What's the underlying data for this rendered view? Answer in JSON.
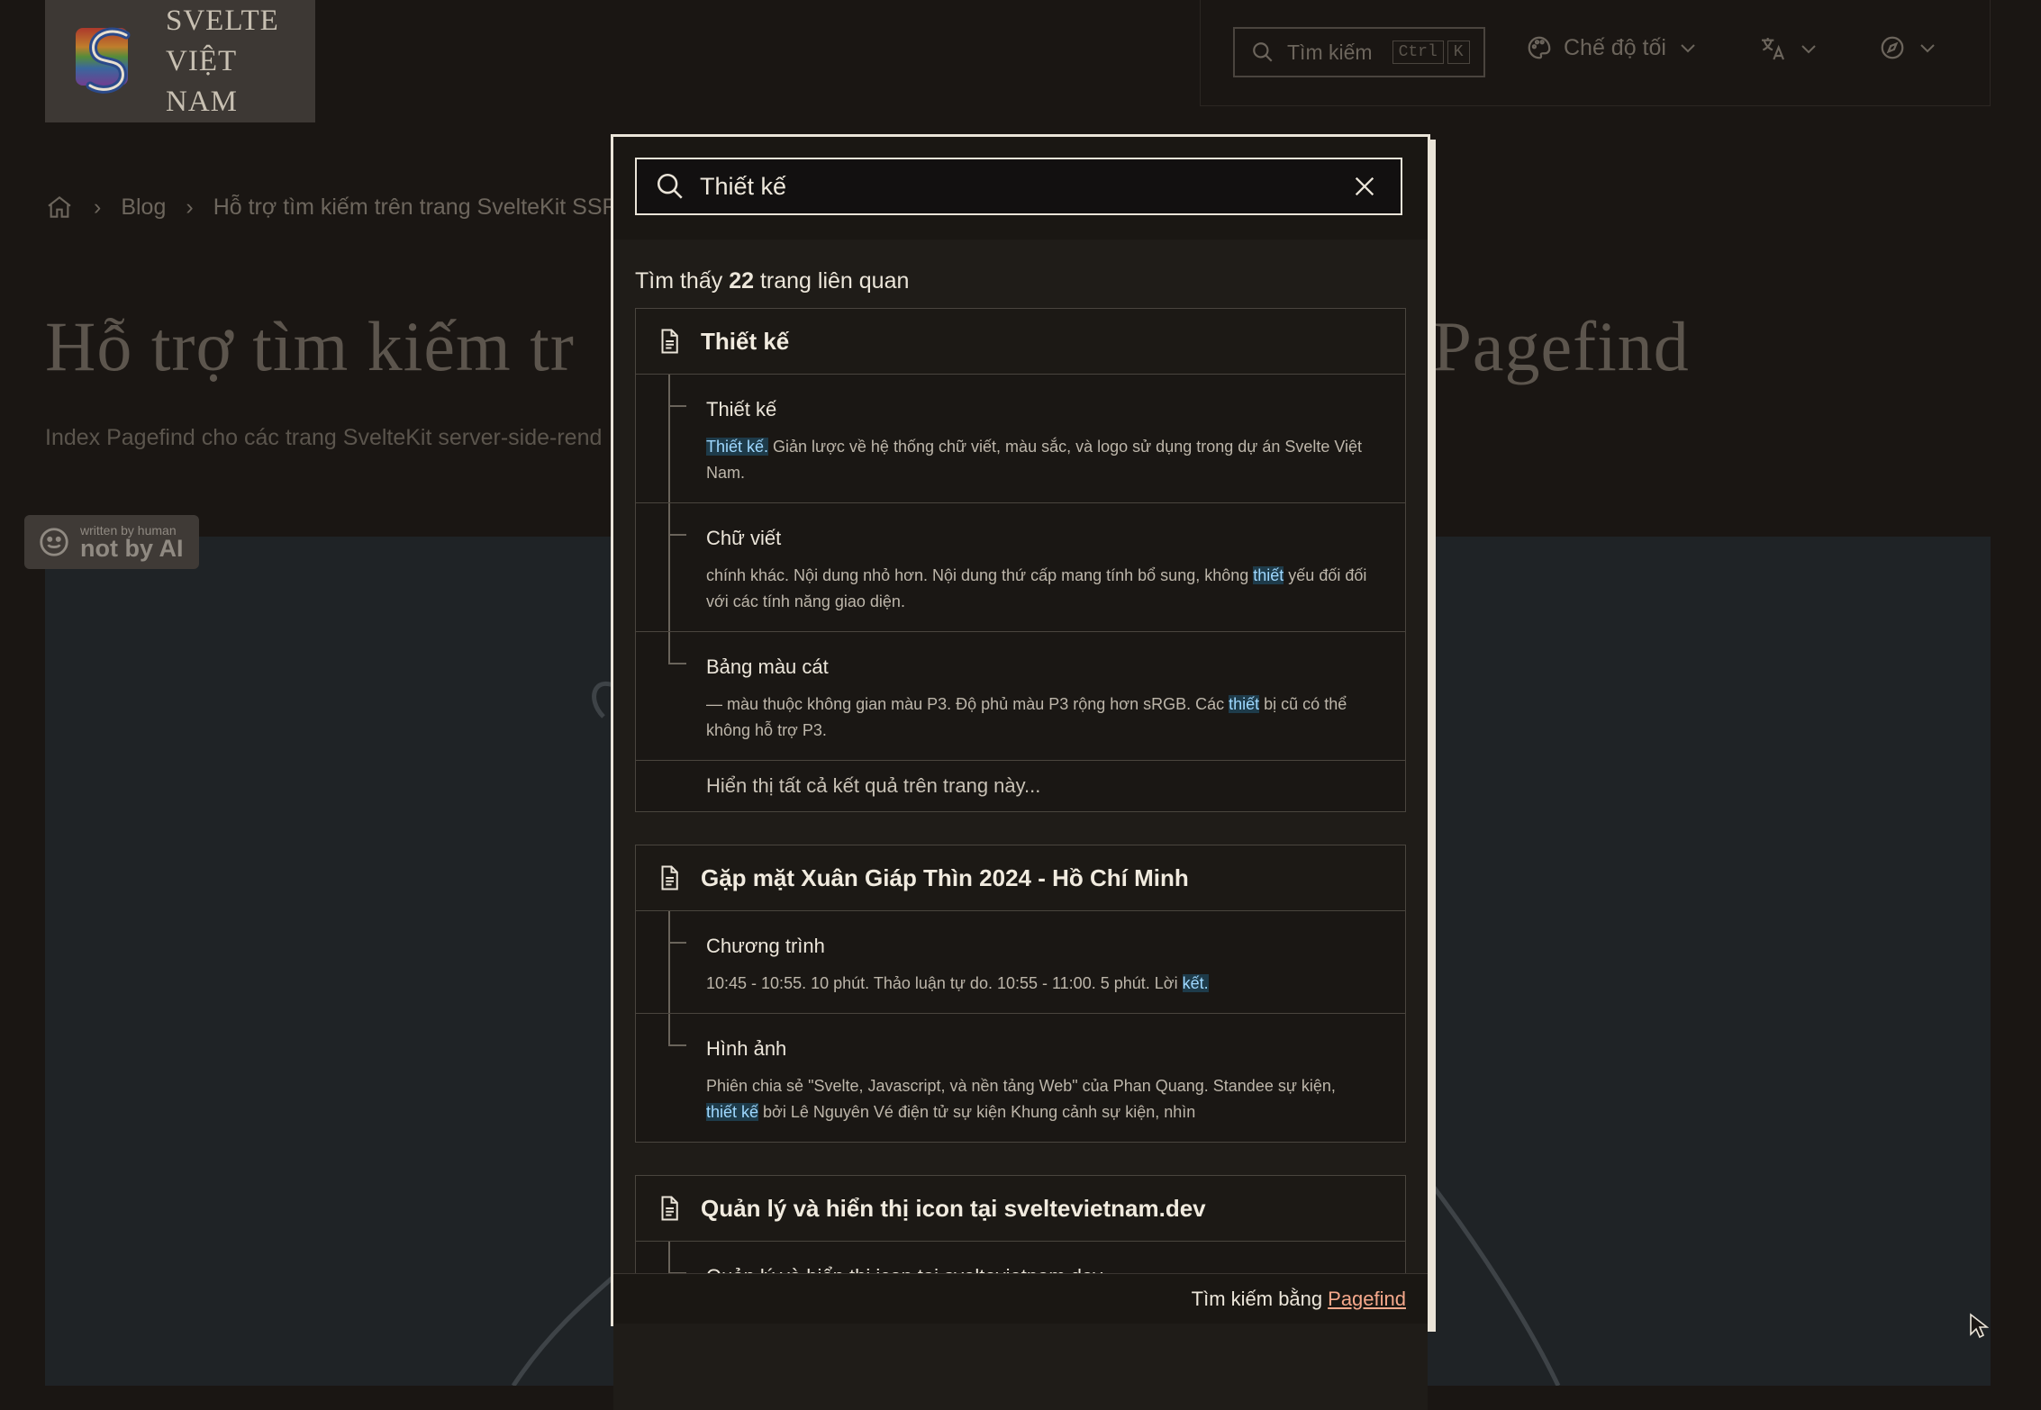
{
  "logo": {
    "line1": "SVELTE",
    "line2": "VIỆT NAM"
  },
  "topbar": {
    "search_label": "Tìm kiếm",
    "shortcut_keys": [
      "Ctrl",
      "K"
    ],
    "theme_label": "Chế độ tối"
  },
  "breadcrumb": {
    "items": [
      "Blog",
      "Hỗ trợ tìm kiếm trên trang SvelteKit SSR"
    ]
  },
  "page": {
    "title_left": "Hỗ trợ tìm kiếm tr",
    "title_right": "g Pagefind",
    "subtitle": "Index Pagefind cho các trang SvelteKit server-side-rend"
  },
  "badge": {
    "small": "written by human",
    "big": "not by AI"
  },
  "search": {
    "query": "Thiết kế",
    "results_prefix": "Tìm thấy",
    "results_count": "22",
    "results_suffix": "trang liên quan",
    "show_all_label": "Hiển thị tất cả kết quả trên trang này...",
    "footer_prefix": "Tìm kiếm bằng",
    "footer_link": "Pagefind",
    "groups": [
      {
        "title": "Thiết kế",
        "subs": [
          {
            "title": "Thiết kế",
            "text_pre": "",
            "hl": "Thiết kế.",
            "text_post": " Giản lược về hệ thống chữ viết, màu sắc, và logo sử dụng trong dự án Svelte Việt Nam."
          },
          {
            "title": "Chữ viết",
            "text_pre": "chính khác. Nội dung nhỏ hơn. Nội dung thứ cấp mang tính bổ sung, không ",
            "hl": "thiết",
            "text_post": " yếu đối đối với các tính năng giao diện."
          },
          {
            "title": "Bảng màu cát",
            "text_pre": "— màu thuộc không gian màu P3. Độ phủ màu P3 rộng hơn sRGB. Các ",
            "hl": "thiết",
            "text_post": " bị cũ có thể không hỗ trợ P3."
          }
        ]
      },
      {
        "title": "Gặp mặt Xuân Giáp Thìn 2024 - Hồ Chí Minh",
        "subs": [
          {
            "title": "Chương trình",
            "text_pre": "10:45 - 10:55. 10 phút. Thảo luận tự do. 10:55 - 11:00. 5 phút. Lời ",
            "hl": "kết.",
            "text_post": ""
          },
          {
            "title": "Hình ảnh",
            "text_pre": "Phiên chia sẻ \"Svelte, Javascript, và nền tảng Web\" của Phan Quang. Standee sự kiện, ",
            "hl": "thiết kế",
            "text_post": " bởi Lê Nguyên Vé điện tử sự kiện Khung cảnh sự kiện, nhìn"
          }
        ]
      },
      {
        "title": "Quản lý và hiển thị icon tại sveltevietnam.dev",
        "subs": [
          {
            "title": "Quản lý và hiển thị icon tại sveltevietnam.dev",
            "text_pre": "",
            "hl": "",
            "text_post": ""
          }
        ]
      }
    ]
  },
  "colors": {
    "accent_link": "#f5a88b",
    "highlight_bg": "#1e3b4a",
    "modal_border": "#eae4d8"
  }
}
